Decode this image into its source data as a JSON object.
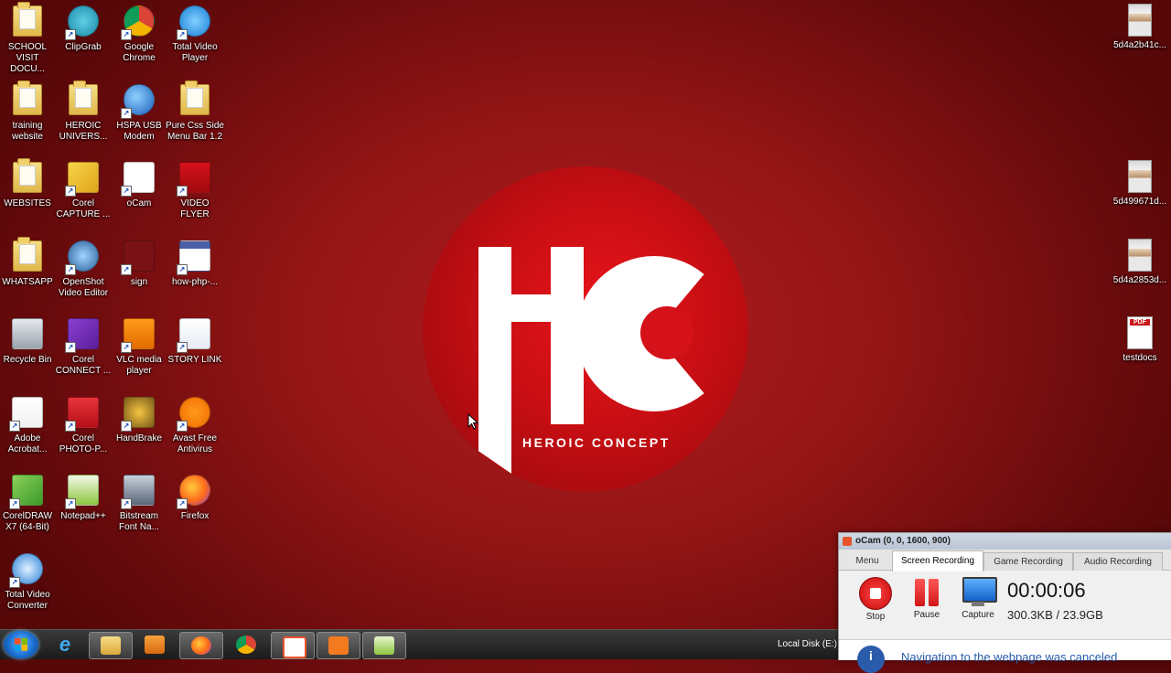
{
  "desktop": {
    "icons": [
      {
        "label": "SCHOOL VISIT DOCU...",
        "icon": "folder-icon"
      },
      {
        "label": "ClipGrab",
        "icon": "clipgrab-icon"
      },
      {
        "label": "Google Chrome",
        "icon": "chrome-icon"
      },
      {
        "label": "Total Video Player",
        "icon": "video-player-icon"
      },
      {
        "label": "training website",
        "icon": "folder-icon"
      },
      {
        "label": "HEROIC UNIVERS...",
        "icon": "folder-icon"
      },
      {
        "label": "HSPA USB Modem",
        "icon": "globe-icon"
      },
      {
        "label": "Pure Css Side Menu Bar 1.2",
        "icon": "folder-icon"
      },
      {
        "label": "WEBSITES",
        "icon": "folder-icon"
      },
      {
        "label": "Corel CAPTURE ...",
        "icon": "corel-capture-icon"
      },
      {
        "label": "oCam",
        "icon": "ocam-icon"
      },
      {
        "label": "VIDEO FLYER",
        "icon": "video-flyer-icon"
      },
      {
        "label": "WHATSAPP",
        "icon": "folder-icon"
      },
      {
        "label": "OpenShot Video Editor",
        "icon": "openshot-icon"
      },
      {
        "label": "sign",
        "icon": "signature-icon"
      },
      {
        "label": "how-php-...",
        "icon": "webpage-icon"
      },
      {
        "label": "Recycle Bin",
        "icon": "recycle-bin-icon"
      },
      {
        "label": "Corel CONNECT ...",
        "icon": "corel-connect-icon"
      },
      {
        "label": "VLC media player",
        "icon": "vlc-icon"
      },
      {
        "label": "STORY LINK",
        "icon": "document-icon"
      },
      {
        "label": "Adobe Acrobat...",
        "icon": "acrobat-icon"
      },
      {
        "label": "Corel PHOTO-P...",
        "icon": "corel-photopaint-icon"
      },
      {
        "label": "HandBrake",
        "icon": "handbrake-icon"
      },
      {
        "label": "Avast Free Antivirus",
        "icon": "avast-icon"
      },
      {
        "label": "CorelDRAW X7 (64-Bit)",
        "icon": "coreldraw-icon"
      },
      {
        "label": "Notepad++",
        "icon": "notepadpp-icon"
      },
      {
        "label": "Bitstream Font Na...",
        "icon": "font-navigator-icon"
      },
      {
        "label": "Firefox",
        "icon": "firefox-icon"
      },
      {
        "label": "Total Video Converter",
        "icon": "video-converter-icon"
      }
    ],
    "right_icons": [
      {
        "label": "5d4a2b41c...",
        "icon": "photo-icon"
      },
      {
        "label": "5d499671d...",
        "icon": "photo-icon"
      },
      {
        "label": "5d4a2853d...",
        "icon": "photo-icon"
      },
      {
        "label": "testdocs",
        "icon": "pdf-icon"
      }
    ]
  },
  "wallpaper": {
    "tagline": "HEROIC CONCEPT",
    "primary_color": "#c70e13"
  },
  "taskbar": {
    "items": [
      "windows-explorer-icon",
      "internet-explorer-icon",
      "file-explorer-icon",
      "media-player-icon",
      "firefox-icon",
      "chrome-icon",
      "ocam-icon",
      "xampp-icon",
      "notepadpp-icon"
    ],
    "drive_label": "Local Disk (E:)"
  },
  "ocam": {
    "title": "oCam (0, 0, 1600, 900)",
    "tabs": [
      "Menu",
      "Screen Recording",
      "Game Recording",
      "Audio Recording"
    ],
    "selected_tab": "Screen Recording",
    "stop_label": "Stop",
    "pause_label": "Pause",
    "capture_label": "Capture",
    "timer": "00:00:06",
    "size": "300.3KB / 23.9GB",
    "notice": "Navigation to the webpage was canceled"
  }
}
